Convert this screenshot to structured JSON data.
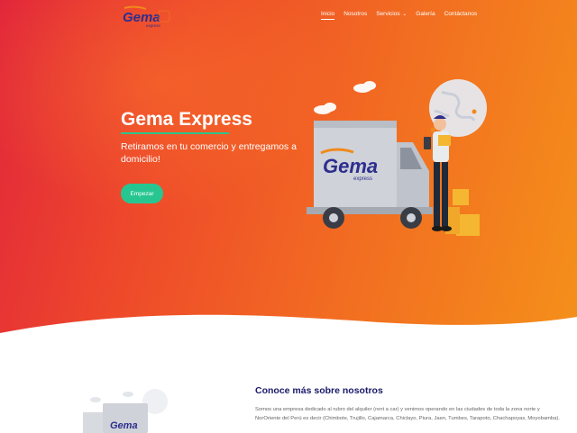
{
  "brand": {
    "logo_main": "Gema",
    "logo_sub": "express"
  },
  "nav": {
    "items": [
      {
        "label": "Inicio",
        "active": true
      },
      {
        "label": "Nosotros"
      },
      {
        "label": "Servicios",
        "has_dropdown": true
      },
      {
        "label": "Galería"
      },
      {
        "label": "Contáctanos"
      }
    ]
  },
  "hero": {
    "title_light": "Gema ",
    "title_bold": "Express",
    "subtitle": "Retiramos en tu comercio y entregamos a domicilio!",
    "cta_label": "Empezar",
    "truck_brand": "Gema",
    "truck_sub": "express"
  },
  "about": {
    "title": "Conoce más sobre nosotros",
    "text": "Somos una empresa dedicado al rubro del alquiler (rent a car) y venimos operando en las ciudades de toda la zona norte y NorOriente del Perú es decir (Chimbote, Trujillo, Cajamarca, Chiclayo, Piura, Jaen, Tumbes, Tarapoto, Chachapoyas, Moyobamba).",
    "truck_brand": "Gema"
  },
  "colors": {
    "accent": "#27c691",
    "hero_start": "#e2263b",
    "hero_end": "#f4901a",
    "heading": "#1a1a6a",
    "logo_blue": "#2d2e8e",
    "logo_orange": "#f08a1c"
  }
}
